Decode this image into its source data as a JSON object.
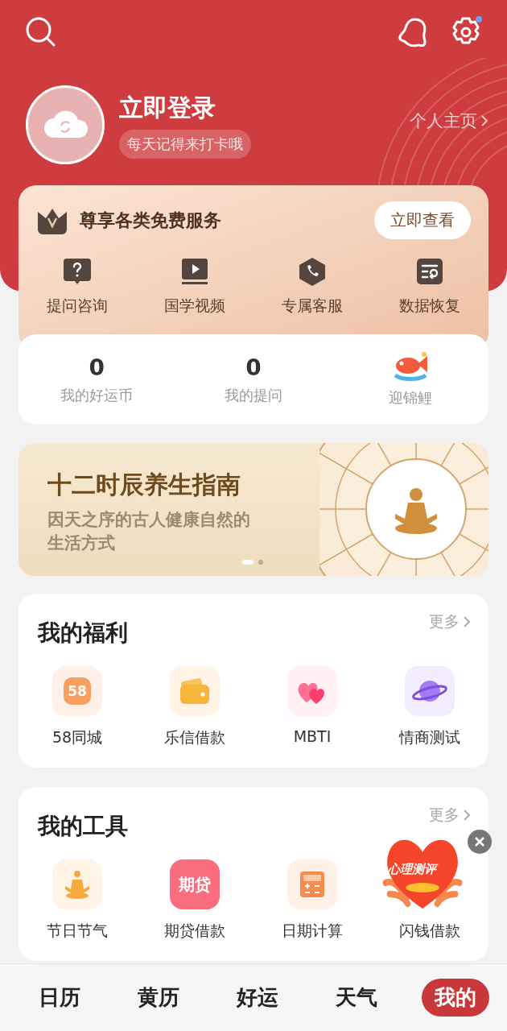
{
  "header": {
    "title": "立即登录",
    "subtitle": "每天记得来打卡哦",
    "profile_link": "个人主页",
    "settings_badge": true
  },
  "vip": {
    "title": "尊享各类免费服务",
    "button": "立即查看",
    "services": [
      {
        "label": "提问咨询",
        "kind": "question"
      },
      {
        "label": "国学视频",
        "kind": "video"
      },
      {
        "label": "专属客服",
        "kind": "phone"
      },
      {
        "label": "数据恢复",
        "kind": "restore"
      }
    ]
  },
  "stats": [
    {
      "kind": "count",
      "value": "0",
      "label": "我的好运币"
    },
    {
      "kind": "count",
      "value": "0",
      "label": "我的提问"
    },
    {
      "kind": "image",
      "label": "迎锦鲤"
    }
  ],
  "banner": {
    "title": "十二时辰养生指南",
    "subtitle": "因天之序的古人健康自然的生活方式",
    "pages": [
      {
        "selected": true
      },
      {
        "selected": false
      }
    ]
  },
  "welfare": {
    "title": "我的福利",
    "more": "更多",
    "items": [
      {
        "label": "58同城",
        "kind": "city",
        "icon_text": "58"
      },
      {
        "label": "乐信借款",
        "kind": "wallet"
      },
      {
        "label": "MBTI",
        "kind": "hearts"
      },
      {
        "label": "情商测试",
        "kind": "planet"
      }
    ]
  },
  "tools": {
    "title": "我的工具",
    "more": "更多",
    "items": [
      {
        "label": "节日节气",
        "kind": "meditation"
      },
      {
        "label": "期贷借款",
        "kind": "loan",
        "icon_text": "期贷"
      },
      {
        "label": "日期计算",
        "kind": "calculator"
      },
      {
        "label": "闪钱借款",
        "kind": "hidden"
      }
    ]
  },
  "floating_ad": {
    "text": "心理测评"
  },
  "tabs": [
    {
      "label": "日历",
      "selected": false
    },
    {
      "label": "黄历",
      "selected": false
    },
    {
      "label": "好运",
      "selected": false
    },
    {
      "label": "天气",
      "selected": false
    },
    {
      "label": "我的",
      "selected": true
    }
  ]
}
